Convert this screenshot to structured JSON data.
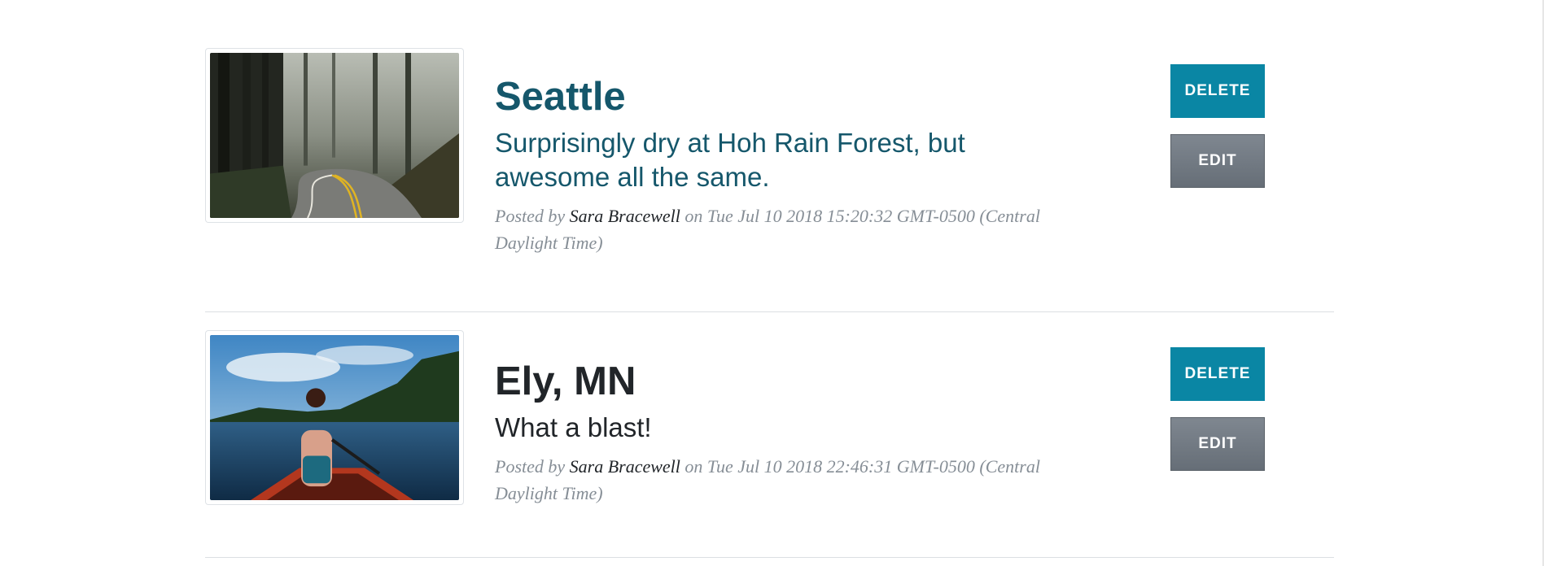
{
  "colors": {
    "primary_title": "#15576b",
    "delete_button": "#0a86a4",
    "edit_button": "#6c757d",
    "meta_text": "#868e96"
  },
  "posts": [
    {
      "image_alt": "forest-road-photo",
      "title": "Seattle",
      "description": "Surprisingly dry at Hoh Rain Forest, but awesome all the same.",
      "meta_prefix": "Posted by ",
      "author": "Sara Bracewell",
      "meta_suffix": " on Tue Jul 10 2018 15:20:32 GMT-0500 (Central Daylight Time)",
      "delete_label": "DELETE",
      "edit_label": "EDIT"
    },
    {
      "image_alt": "canoe-lake-photo",
      "title": "Ely, MN",
      "description": "What a blast!",
      "meta_prefix": "Posted by ",
      "author": "Sara Bracewell",
      "meta_suffix": " on Tue Jul 10 2018 22:46:31 GMT-0500 (Central Daylight Time)",
      "delete_label": "DELETE",
      "edit_label": "EDIT"
    }
  ]
}
